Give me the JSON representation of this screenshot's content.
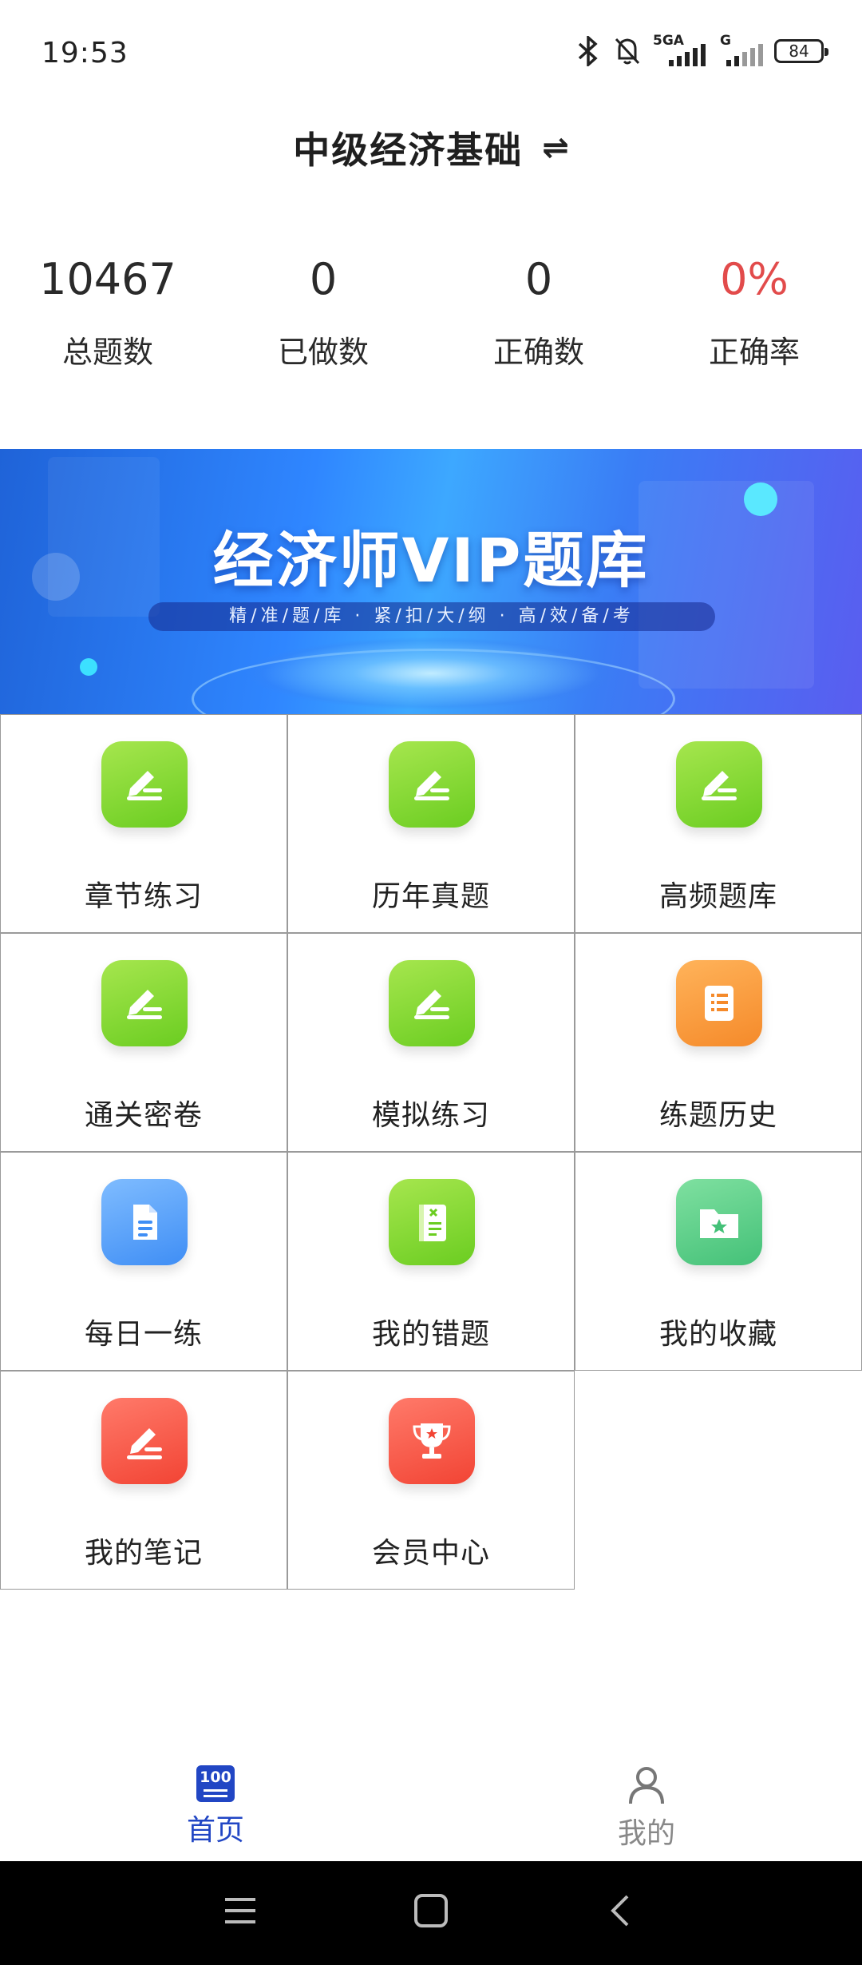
{
  "status_bar": {
    "time": "19:53",
    "network_label": "5GA",
    "network_label_2": "G",
    "battery": "84",
    "icons": [
      "bluetooth-icon",
      "mute-bell-icon",
      "signal-icon",
      "signal-icon-2"
    ]
  },
  "header": {
    "title": "中级经济基础",
    "switch_icon": "⇌"
  },
  "stats": [
    {
      "value": "10467",
      "label": "总题数"
    },
    {
      "value": "0",
      "label": "已做数"
    },
    {
      "value": "0",
      "label": "正确数"
    },
    {
      "value": "0%",
      "label": "正确率"
    }
  ],
  "banner": {
    "title": "经济师VIP题库",
    "subtitle": "精/准/题/库 · 紧/扣/大/纲 · 高/效/备/考"
  },
  "grid": [
    {
      "label": "章节练习",
      "icon": "edit-icon",
      "color": "green"
    },
    {
      "label": "历年真题",
      "icon": "edit-icon",
      "color": "green"
    },
    {
      "label": "高频题库",
      "icon": "edit-icon",
      "color": "green"
    },
    {
      "label": "通关密卷",
      "icon": "edit-icon",
      "color": "green"
    },
    {
      "label": "模拟练习",
      "icon": "edit-icon",
      "color": "green"
    },
    {
      "label": "练题历史",
      "icon": "scroll-icon",
      "color": "orange"
    },
    {
      "label": "每日一练",
      "icon": "document-icon",
      "color": "blue"
    },
    {
      "label": "我的错题",
      "icon": "notebook-icon",
      "color": "green"
    },
    {
      "label": "我的收藏",
      "icon": "star-folder-icon",
      "color": "teal"
    },
    {
      "label": "我的笔记",
      "icon": "pen-icon",
      "color": "red"
    },
    {
      "label": "会员中心",
      "icon": "trophy-icon",
      "color": "red"
    }
  ],
  "bottom_nav": {
    "home_label": "首页",
    "home_badge": "100",
    "mine_label": "我的"
  },
  "colors": {
    "accent": "#2146c4",
    "rate": "#e24b4b",
    "green": "#7ed32c",
    "orange": "#f7982f",
    "blue": "#4a97f7",
    "teal": "#4fc681",
    "red": "#f4493a"
  }
}
